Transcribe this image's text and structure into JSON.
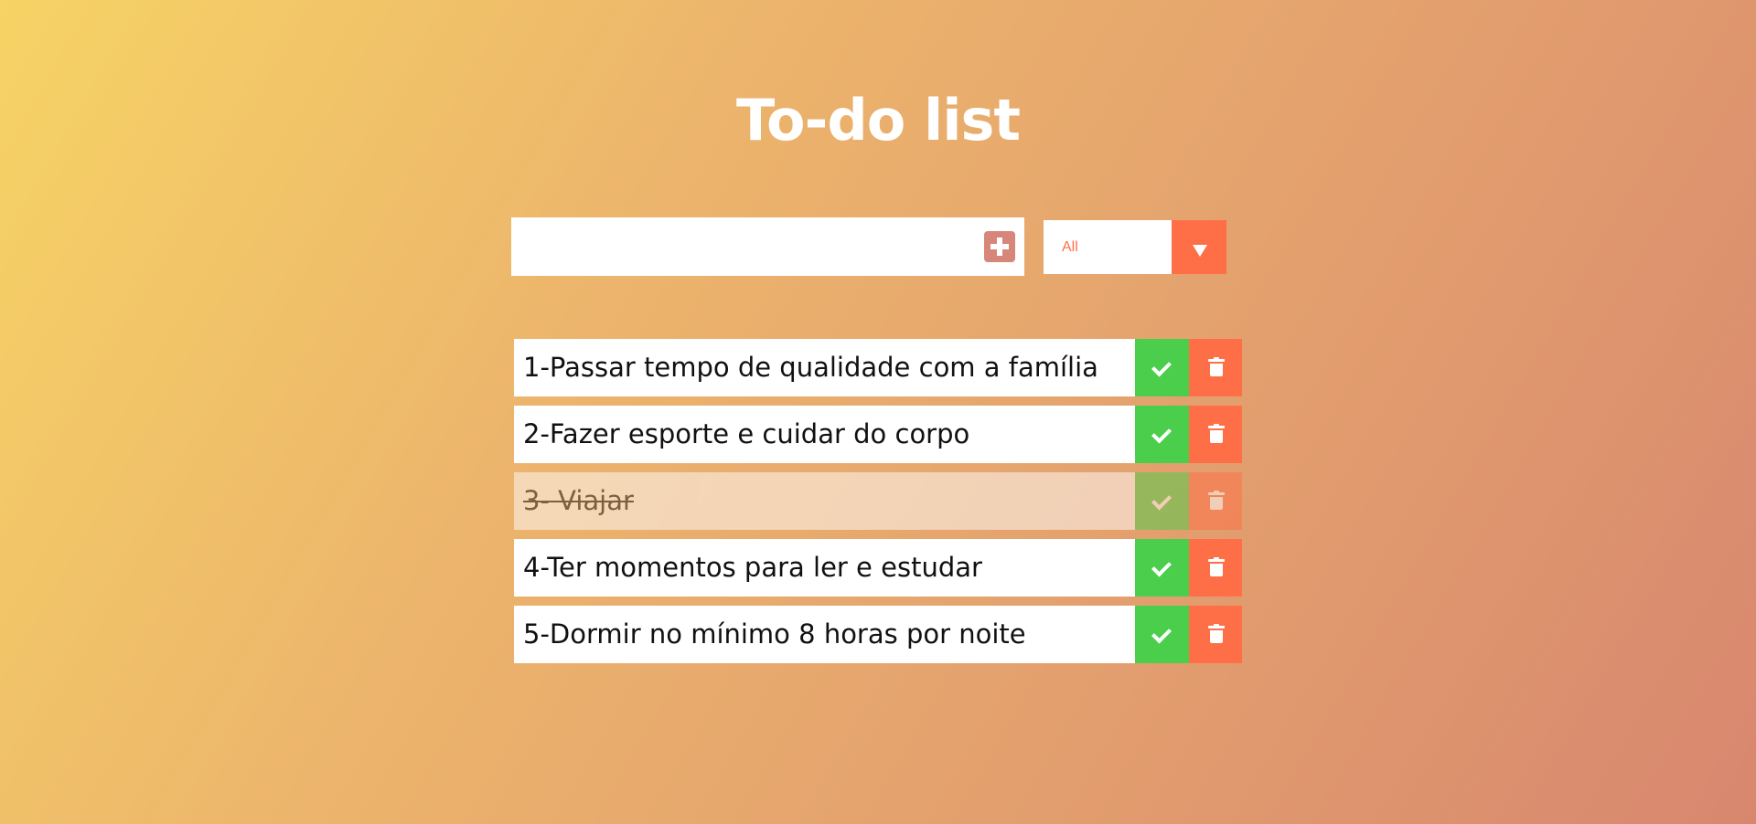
{
  "app": {
    "title": "To-do list"
  },
  "input": {
    "value": "",
    "placeholder": "",
    "add_icon": "plus-square-icon"
  },
  "filter": {
    "selected": "All",
    "arrow_icon": "caret-down-icon"
  },
  "colors": {
    "background_start": "#f6d365",
    "background_end": "#d8876f",
    "check_button": "#4bce4b",
    "trash_button": "#ff6f47",
    "add_button": "#d6877a"
  },
  "todos": [
    {
      "text": "1-Passar tempo de qualidade com a família",
      "completed": false
    },
    {
      "text": "2-Fazer esporte e cuidar do corpo",
      "completed": false
    },
    {
      "text": "3- Viajar",
      "completed": true
    },
    {
      "text": "4-Ter momentos para ler e estudar",
      "completed": false
    },
    {
      "text": "5-Dormir no mínimo 8 horas por noite",
      "completed": false
    }
  ],
  "icons": {
    "check": "check-icon",
    "trash": "trash-icon"
  }
}
